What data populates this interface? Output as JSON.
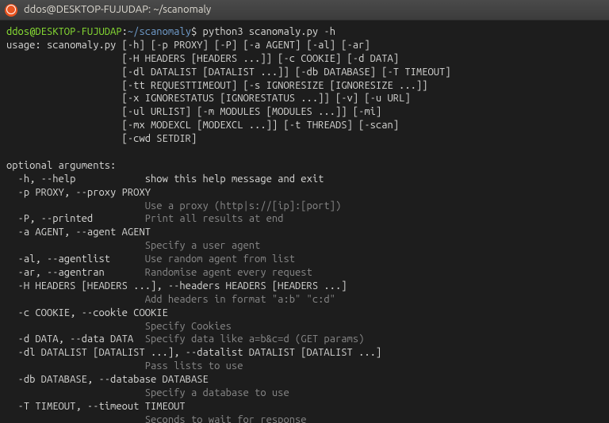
{
  "titlebar": {
    "text": "ddos@DESKTOP-FUJUDAP: ~/scanomaly"
  },
  "prompt": {
    "user": "ddos",
    "at": "@",
    "host": "DESKTOP-FUJUDAP",
    "colon": ":",
    "path": "~/scanomaly",
    "dollar": "$ ",
    "command": "python3 scanomaly.py -h"
  },
  "usage": {
    "l1": "usage: scanomaly.py [-h] [-p PROXY] [-P] [-a AGENT] [-al] [-ar]",
    "l2": "                    [-H HEADERS [HEADERS ...]] [-c COOKIE] [-d DATA]",
    "l3": "                    [-dl DATALIST [DATALIST ...]] [-db DATABASE] [-T TIMEOUT]",
    "l4": "                    [-tt REQUESTTIMEOUT] [-s IGNORESIZE [IGNORESIZE ...]]",
    "l5": "                    [-x IGNORESTATUS [IGNORESTATUS ...]] [-v] [-u URL]",
    "l6": "                    [-ul URLIST] [-m MODULES [MODULES ...]] [-mi]",
    "l7": "                    [-mx MODEXCL [MODEXCL ...]] [-t THREADS] [-scan]",
    "l8": "                    [-cwd SETDIR]"
  },
  "optheader": "optional arguments:",
  "args": {
    "help_flag": "  -h, --help            ",
    "help_desc": "show this help message and exit",
    "proxy_flag": "  -p PROXY, --proxy PROXY",
    "proxy_desc": "                        Use a proxy (http|s://[ip]:[port])",
    "printed_flag": "  -P, --printed         ",
    "printed_desc": "Print all results at end",
    "agent_flag": "  -a AGENT, --agent AGENT",
    "agent_desc": "                        Specify a user agent",
    "agentlist_flag": "  -al, --agentlist      ",
    "agentlist_desc": "Use random agent from list",
    "agentran_flag": "  -ar, --agentran       ",
    "agentran_desc": "Randomise agent every request",
    "headers_flag": "  -H HEADERS [HEADERS ...], --headers HEADERS [HEADERS ...]",
    "headers_desc": "                        Add headers in format \"a:b\" \"c:d\"",
    "cookie_flag": "  -c COOKIE, --cookie COOKIE",
    "cookie_desc": "                        Specify Cookies",
    "data_flag": "  -d DATA, --data DATA  ",
    "data_desc": "Specify data like a=b&c=d (GET params)",
    "datalist_flag": "  -dl DATALIST [DATALIST ...], --datalist DATALIST [DATALIST ...]",
    "datalist_desc": "                        Pass lists to use",
    "database_flag": "  -db DATABASE, --database DATABASE",
    "database_desc": "                        Specify a database to use",
    "timeout_flag": "  -T TIMEOUT, --timeout TIMEOUT",
    "timeout_desc": "                        Seconds to wait for response"
  }
}
